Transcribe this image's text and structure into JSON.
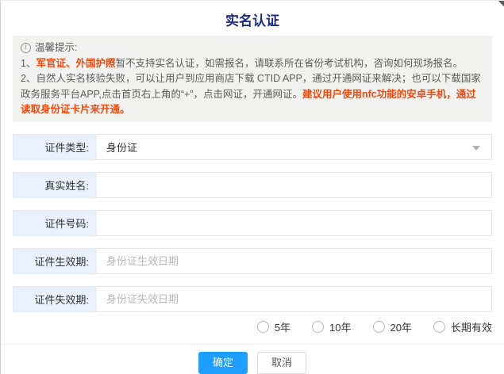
{
  "dialog": {
    "title": "实名认证"
  },
  "notice": {
    "info_icon_glyph": "i",
    "header": "温馨提示:",
    "line1_prefix": "1、",
    "line1_highlight": "军官证、外国护照",
    "line1_rest": "暂不支持实名认证，如需报名，请联系所在省份考试机构，咨询如何现场报名。",
    "line2_prefix": "2、",
    "line2_text": "自然人实名核验失败，可以让用户到应用商店下载 CTID APP，通过开通网证来解决；也可以下载国家政务服务平台APP,点击首页右上角的“+”，点击网证，开通网证。",
    "line2_highlight": "建议用户使用nfc功能的安卓手机，通过读取身份证卡片来开通。"
  },
  "form": {
    "fields": [
      {
        "label": "证件类型:",
        "type": "select",
        "value": "身份证"
      },
      {
        "label": "真实姓名:",
        "type": "text",
        "value": "",
        "placeholder": ""
      },
      {
        "label": "证件号码:",
        "type": "text",
        "value": "",
        "placeholder": ""
      },
      {
        "label": "证件生效期:",
        "type": "text",
        "value": "",
        "placeholder": "身份证生效日期"
      },
      {
        "label": "证件失效期:",
        "type": "text",
        "value": "",
        "placeholder": "身份证失效日期"
      }
    ],
    "validity_options": [
      {
        "label": "5年",
        "checked": false
      },
      {
        "label": "10年",
        "checked": false
      },
      {
        "label": "20年",
        "checked": false
      },
      {
        "label": "长期有效",
        "checked": false
      }
    ]
  },
  "footer": {
    "confirm_label": "确定",
    "cancel_label": "取消"
  },
  "colors": {
    "title_navy": "#1c2b7f",
    "highlight_red": "#f14a0e",
    "primary_blue": "#1e9fff",
    "label_bg": "#e8f1fd",
    "notice_bg": "#f2f2f0"
  }
}
